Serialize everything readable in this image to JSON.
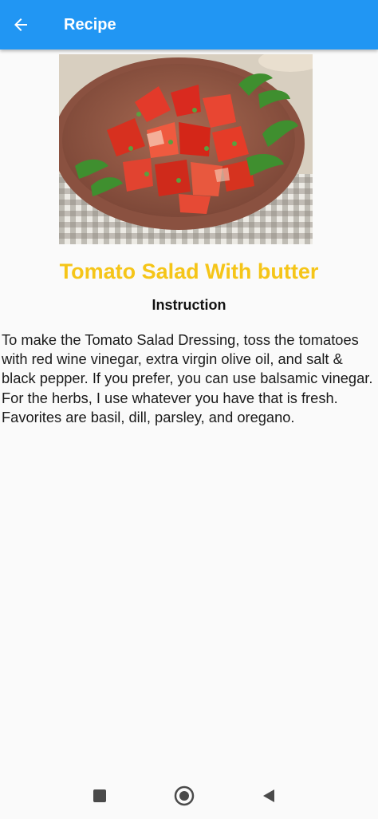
{
  "app_bar": {
    "title": "Recipe",
    "color": "#2196f3",
    "back_icon": "arrow-left-icon"
  },
  "recipe": {
    "image_alt": "tomato-salad-photo",
    "title": "Tomato Salad With butter",
    "title_color": "#f5c518",
    "section_heading": "Instruction",
    "instructions": "To make the Tomato Salad Dressing, toss the tomatoes with red wine vinegar, extra virgin olive oil, and salt & black pepper. If you prefer, you can use balsamic vinegar. For the herbs, I use whatever you have that is fresh. Favorites are basil, dill, parsley, and oregano."
  },
  "system_nav": {
    "recents_icon": "square-icon",
    "home_icon": "circle-icon",
    "back_icon": "triangle-back-icon"
  }
}
